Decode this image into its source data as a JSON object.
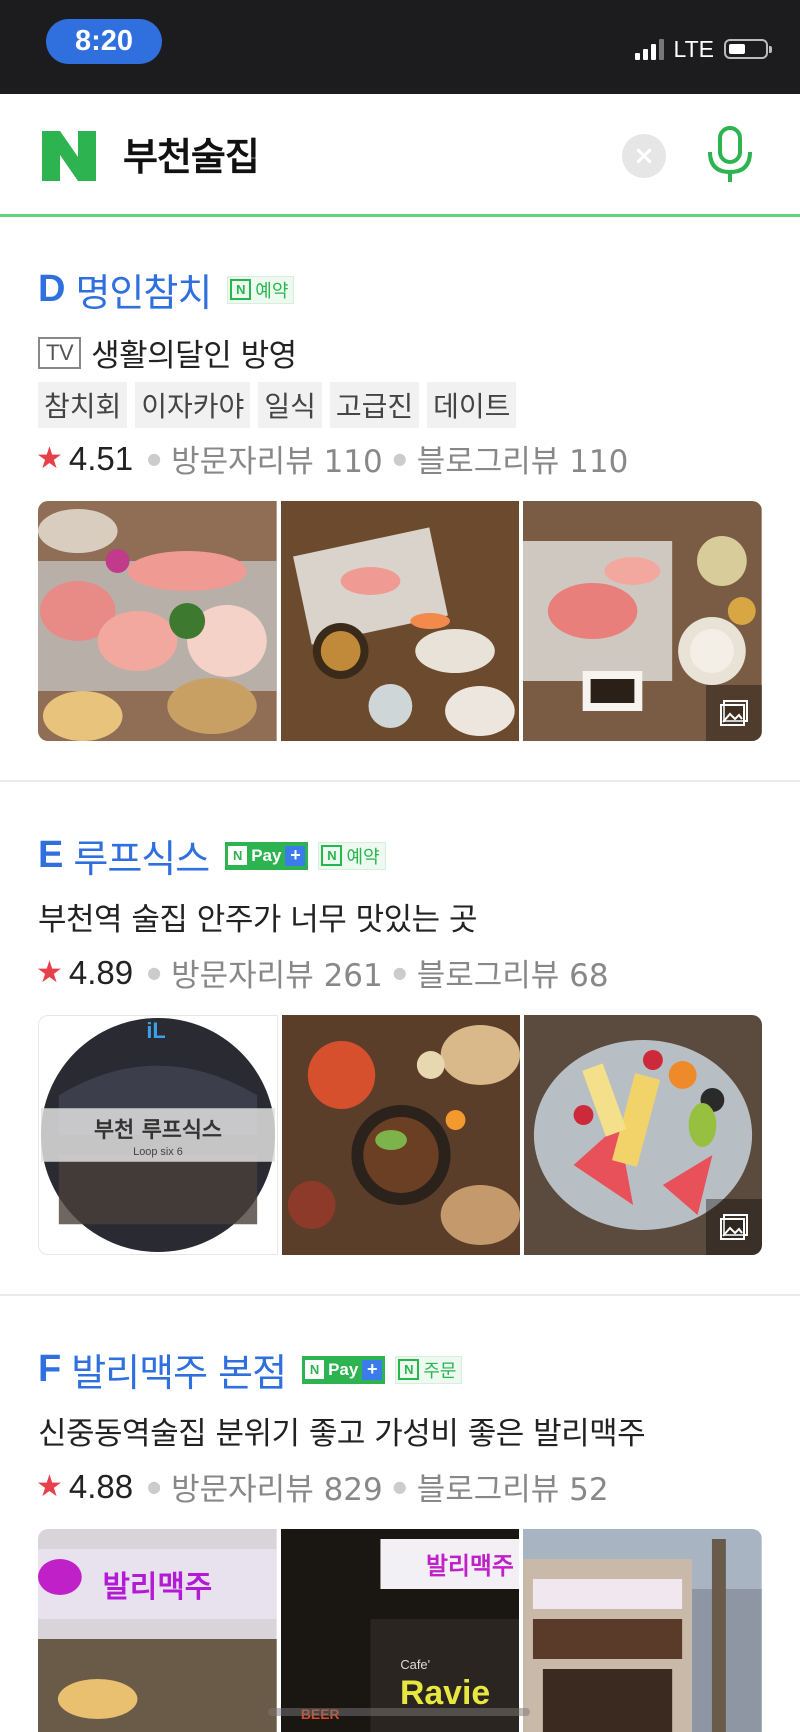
{
  "status_bar": {
    "time": "8:20",
    "network": "LTE"
  },
  "search": {
    "query": "부천술집"
  },
  "results": [
    {
      "letter": "D",
      "name": "명인참치",
      "badges": [
        "예약"
      ],
      "tv_label": "TV",
      "description": "생활의달인 방영",
      "tags": [
        "참치회",
        "이자카야",
        "일식",
        "고급진",
        "데이트"
      ],
      "rating": "4.51",
      "visitor_reviews": "방문자리뷰 110",
      "blog_reviews": "블로그리뷰 110"
    },
    {
      "letter": "E",
      "name": "루프식스",
      "pay_label": "Pay",
      "badges": [
        "예약"
      ],
      "description": "부천역 술집 안주가 너무 맛있는 곳",
      "rating": "4.89",
      "visitor_reviews": "방문자리뷰 261",
      "blog_reviews": "블로그리뷰 68",
      "logo_text": "부천 루프식스",
      "logo_sub": "Loop six 6",
      "logo_mark": "iL"
    },
    {
      "letter": "F",
      "name": "발리맥주 본점",
      "pay_label": "Pay",
      "badges": [
        "주문"
      ],
      "description": "신중동역술집 분위기 좋고 가성비 좋은 발리맥주",
      "rating": "4.88",
      "visitor_reviews": "방문자리뷰 829",
      "blog_reviews": "블로그리뷰 52",
      "sign_text_1": "발리맥주",
      "sign_text_2": "Ravie",
      "sign_text_3": "BEER",
      "sign_text_4": "Cafe'"
    }
  ],
  "colors": {
    "accent_blue": "#2f6fde",
    "naver_green": "#27b74f",
    "star_red": "#e8404a"
  }
}
